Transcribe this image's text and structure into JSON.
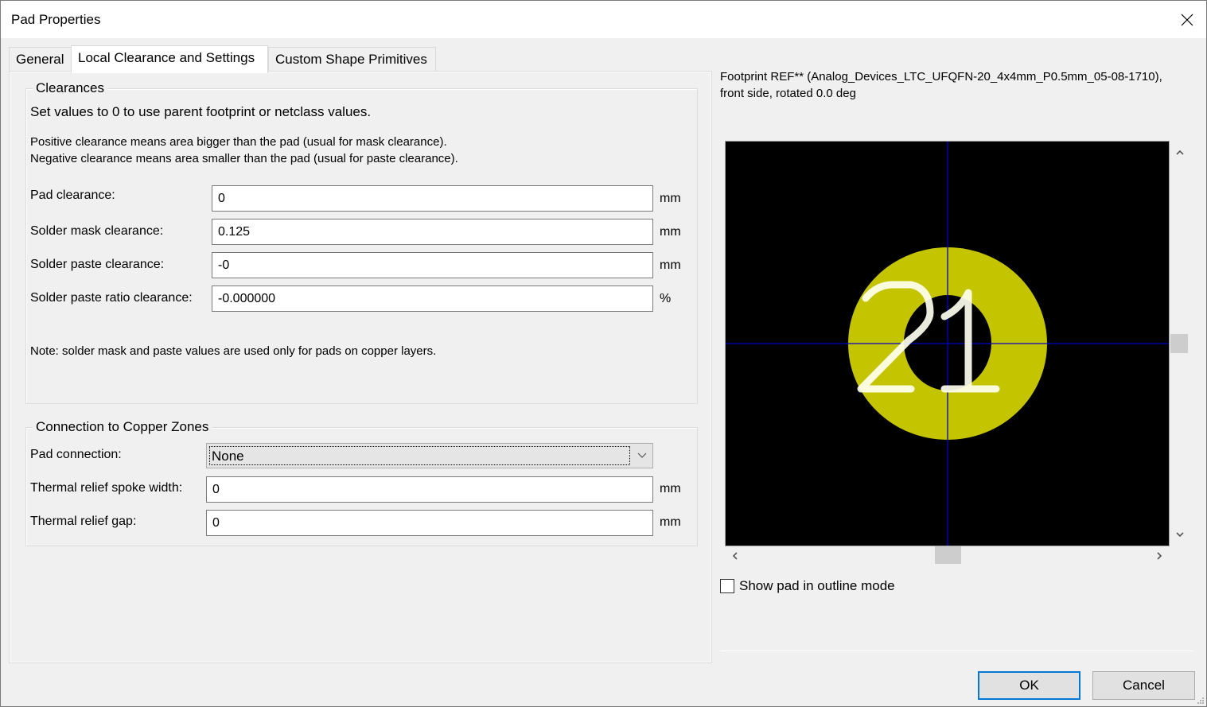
{
  "window": {
    "title": "Pad Properties",
    "close_icon": "close-icon"
  },
  "tabs": [
    {
      "label": "General",
      "active": false
    },
    {
      "label": "Local Clearance and Settings",
      "active": true
    },
    {
      "label": "Custom Shape Primitives",
      "active": false
    }
  ],
  "clearances": {
    "group_title": "Clearances",
    "intro": "Set values to 0 to use parent footprint or netclass values.",
    "explain_line1": "Positive clearance means area bigger than the pad (usual for mask clearance).",
    "explain_line2": "Negative clearance means area smaller than the pad (usual for paste clearance).",
    "fields": [
      {
        "label": "Pad clearance:",
        "value": "0",
        "unit": "mm"
      },
      {
        "label": "Solder mask clearance:",
        "value": "0.125",
        "unit": "mm"
      },
      {
        "label": "Solder paste clearance:",
        "value": "-0",
        "unit": "mm"
      },
      {
        "label": "Solder paste ratio clearance:",
        "value": "-0.000000",
        "unit": "%"
      }
    ],
    "note": "Note: solder mask and paste values are used only for pads on copper layers."
  },
  "zones": {
    "group_title": "Connection to Copper Zones",
    "pad_connection_label": "Pad connection:",
    "pad_connection_value": "None",
    "fields": [
      {
        "label": "Thermal relief spoke width:",
        "value": "0",
        "unit": "mm"
      },
      {
        "label": "Thermal relief gap:",
        "value": "0",
        "unit": "mm"
      }
    ]
  },
  "preview": {
    "caption_line1": "Footprint REF** (Analog_Devices_LTC_UFQFN-20_4x4mm_P0.5mm_05-08-1710),",
    "caption_line2": "front side, rotated 0.0 deg",
    "pad_number": "21",
    "colors": {
      "background": "#000000",
      "pad": "#c4c400",
      "crosshair": "#0000c8",
      "pad_text": "#fffff0"
    },
    "outline_mode_label": "Show pad in outline mode",
    "outline_mode_checked": false
  },
  "buttons": {
    "ok": "OK",
    "cancel": "Cancel"
  }
}
